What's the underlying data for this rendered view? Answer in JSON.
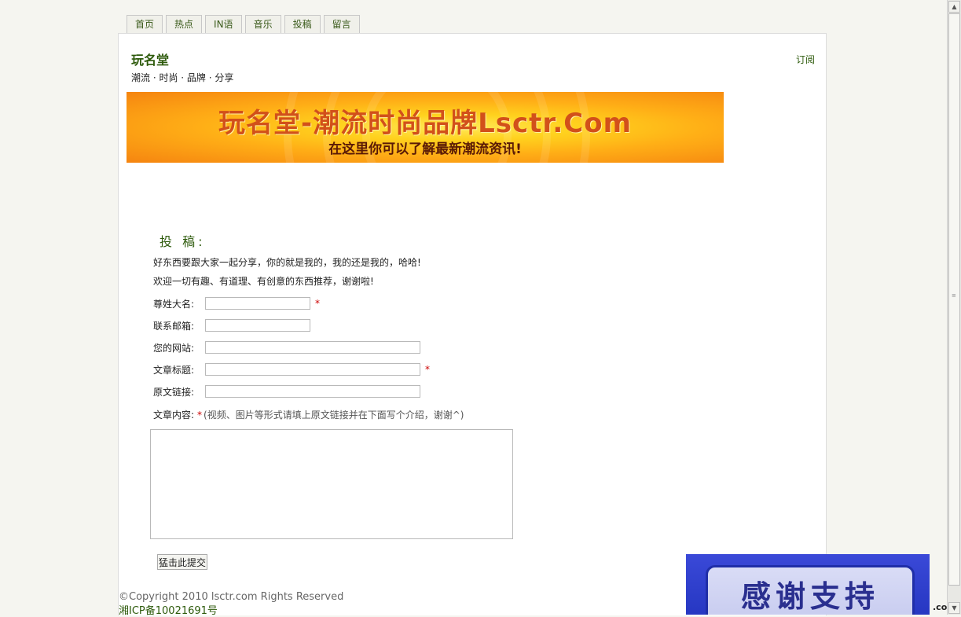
{
  "nav": {
    "tabs": [
      {
        "label": "首页"
      },
      {
        "label": "热点"
      },
      {
        "label": "IN语"
      },
      {
        "label": "音乐"
      },
      {
        "label": "投稿"
      },
      {
        "label": "留言"
      }
    ]
  },
  "header": {
    "site_title": "玩名堂",
    "tagline": "潮流 · 时尚 · 品牌 · 分享",
    "subscribe": "订阅"
  },
  "banner": {
    "title": "玩名堂-潮流时尚品牌Lsctr.Com",
    "subtitle": "在这里你可以了解最新潮流资讯!"
  },
  "submit_form": {
    "heading": "投 稿:",
    "intro_1": "好东西要跟大家一起分享，你的就是我的，我的还是我的，哈哈!",
    "intro_2": "欢迎一切有趣、有道理、有创意的东西推荐，谢谢啦!",
    "required_mark": "*",
    "fields": {
      "name_label": "尊姓大名:",
      "email_label": "联系邮箱:",
      "website_label": "您的网站:",
      "article_title_label": "文章标题:",
      "source_link_label": "原文链接:"
    },
    "content_label": "文章内容:",
    "content_note": "(视频、图片等形式请填上原文链接并在下面写个介绍，谢谢^)",
    "submit_label": "猛击此提交"
  },
  "footer": {
    "copyright": "©Copyright 2010 lsctr.com Rights Reserved",
    "icp": "湘ICP备10021691号"
  },
  "ad": {
    "text": "感谢支持",
    "corner": ".com"
  }
}
